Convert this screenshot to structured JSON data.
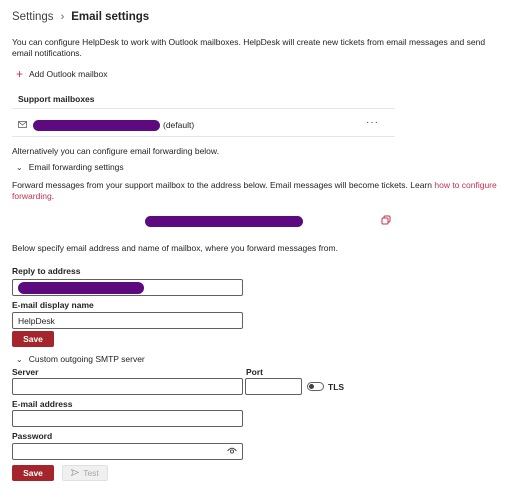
{
  "breadcrumb": {
    "parent": "Settings",
    "separator": "›",
    "current": "Email settings"
  },
  "intro_text": "You can configure HelpDesk to work with Outlook mailboxes. HelpDesk will create new tickets from email messages and send email notifications.",
  "add_mailbox": {
    "icon": "plus-icon",
    "label": "Add Outlook mailbox"
  },
  "support_mailboxes": {
    "header": "Support mailboxes",
    "items": [
      {
        "icon": "mail-icon",
        "suffix": "(default)",
        "more": "···"
      }
    ]
  },
  "alternative_text": "Alternatively you can configure email forwarding below.",
  "forwarding": {
    "toggle_label": "Email forwarding settings",
    "desc_prefix": "Forward messages from your support mailbox to the address below. Email messages will become tickets. Learn ",
    "link": "how to configure forwarding",
    "desc_suffix": ".",
    "copy_icon": "copy-icon"
  },
  "below_text": "Below specify email address and name of mailbox, where you forward messages from.",
  "reply_to": {
    "label": "Reply to address"
  },
  "display_name": {
    "label": "E-mail display name",
    "value": "HelpDesk"
  },
  "save_label": "Save",
  "smtp": {
    "toggle_label": "Custom outgoing SMTP server",
    "server_label": "Server",
    "port_label": "Port",
    "tls_label": "TLS",
    "tls_on": false,
    "email_label": "E-mail address",
    "password_label": "Password",
    "password_icon": "eye-icon",
    "save_label": "Save",
    "test_label": "Test",
    "test_icon": "send-icon"
  },
  "colors": {
    "accent": "#a4262c",
    "link": "#c4314b",
    "redaction": "#5c0a7e"
  }
}
